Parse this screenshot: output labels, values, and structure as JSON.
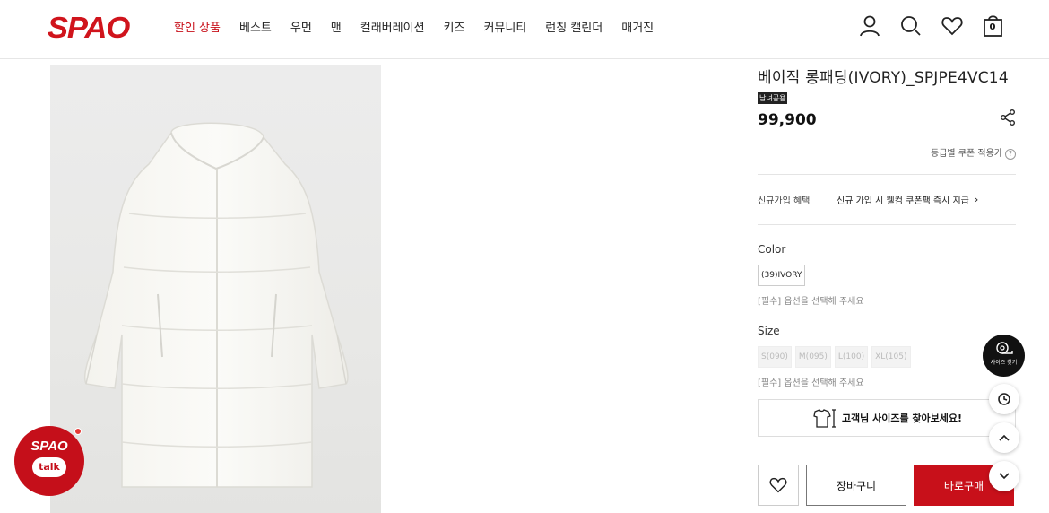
{
  "header": {
    "logo": "SPAO",
    "nav": [
      "할인 상품",
      "베스트",
      "우먼",
      "맨",
      "컬래버레이션",
      "키즈",
      "커뮤니티",
      "런칭 캘린더",
      "매거진"
    ],
    "cart_count": "0"
  },
  "product": {
    "title": "베이직 롱패딩(IVORY)_SPJPE4VC14",
    "badge": "남녀공용",
    "price": "99,900",
    "coupon_text": "등급별 쿠폰 적용가",
    "benefit_label": "신규가입 혜택",
    "benefit_value": "신규 가입 시 웰컴 쿠폰팩 즉시 지급",
    "color_label": "Color",
    "color_options": [
      "(39)IVORY"
    ],
    "color_hint": "[필수] 옵션을 선택해 주세요",
    "size_label": "Size",
    "size_options": [
      "S(090)",
      "M(095)",
      "L(100)",
      "XL(105)"
    ],
    "size_hint": "[필수] 옵션을 선택해 주세요",
    "size_finder": "고객님 사이즈를 찾아보세요!",
    "cart_button": "장바구니",
    "buy_button": "바로구매"
  },
  "floating": {
    "size_find_label": "사이즈 찾기"
  },
  "chat": {
    "logo": "SPAO",
    "label": "talk"
  },
  "colors": {
    "brand_red": "#c8101a"
  }
}
